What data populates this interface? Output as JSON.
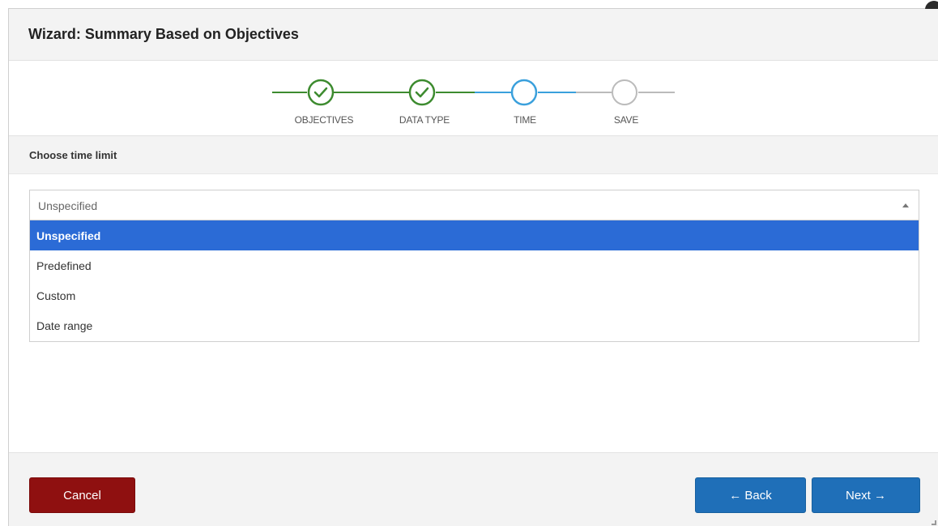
{
  "dialog": {
    "title": "Wizard: Summary Based on Objectives"
  },
  "stepper": {
    "steps": [
      {
        "label": "OBJECTIVES",
        "state": "complete"
      },
      {
        "label": "DATA TYPE",
        "state": "complete"
      },
      {
        "label": "TIME",
        "state": "current"
      },
      {
        "label": "SAVE",
        "state": "pending"
      }
    ],
    "colors": {
      "complete": "#3d8b2f",
      "current": "#3aa0dc",
      "pending": "#bbbbbb"
    }
  },
  "section": {
    "heading": "Choose time limit"
  },
  "time_limit_select": {
    "value": "Unspecified",
    "options": [
      "Unspecified",
      "Predefined",
      "Custom",
      "Date range"
    ],
    "highlighted_option": "Unspecified"
  },
  "footer": {
    "cancel_label": "Cancel",
    "back_label": "← Back",
    "next_label": "Next →"
  }
}
